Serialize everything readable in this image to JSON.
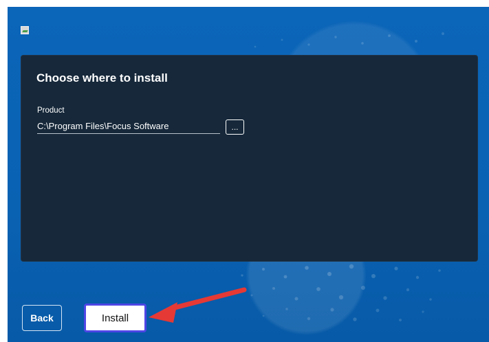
{
  "app": {
    "window_icon": "broken-image-icon"
  },
  "panel": {
    "title": "Choose where to install",
    "field_label": "Product",
    "path_value": "C:\\Program Files\\Focus Software",
    "browse_label": "..."
  },
  "footer": {
    "back_label": "Back",
    "install_label": "Install"
  },
  "colors": {
    "window_background": "#0a64b6",
    "panel_background": "#16283a",
    "install_focus": "#4e46e5",
    "annotation_arrow": "#e53935"
  },
  "annotation": {
    "icon": "red-arrow-icon"
  }
}
